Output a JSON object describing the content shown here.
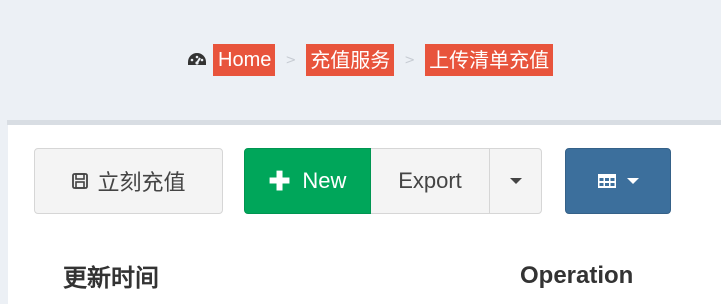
{
  "colors": {
    "breadcrumb_highlight": "#e8543c",
    "new_button": "#00a65a",
    "columns_button": "#3c6f9c",
    "page_bg": "#ecf0f5"
  },
  "breadcrumb": {
    "icon": "dashboard-icon",
    "items": [
      {
        "label": "Home"
      },
      {
        "label": "充值服务"
      },
      {
        "label": "上传清单充值"
      }
    ],
    "separator": ">"
  },
  "toolbar": {
    "recharge_icon": "save-icon",
    "recharge_label": "立刻充值",
    "new_icon": "plus-icon",
    "new_label": "New",
    "export_label": "Export",
    "export_caret_icon": "caret-down-icon",
    "columns_icon": "table-icon",
    "columns_caret_icon": "caret-down-icon"
  },
  "table": {
    "columns": [
      {
        "label": "更新时间"
      },
      {
        "label": "Operation"
      }
    ]
  }
}
